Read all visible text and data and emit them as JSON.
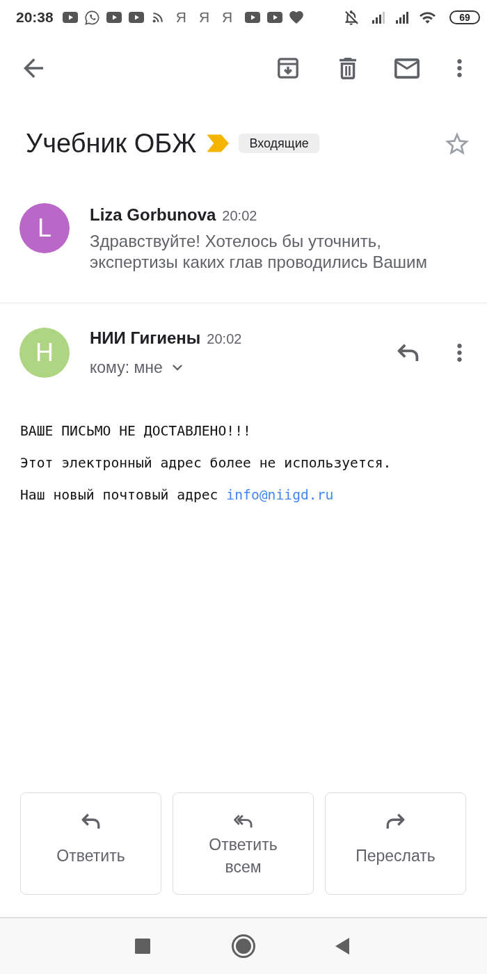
{
  "status_bar": {
    "time": "20:38",
    "notifications": [
      {
        "kind": "video"
      },
      {
        "kind": "chat"
      },
      {
        "kind": "video"
      },
      {
        "kind": "video"
      },
      {
        "kind": "feed"
      },
      {
        "kind": "glyph",
        "glyph": "Я"
      },
      {
        "kind": "glyph",
        "glyph": "Я"
      },
      {
        "kind": "glyph",
        "glyph": "Я"
      },
      {
        "kind": "video"
      },
      {
        "kind": "video"
      },
      {
        "kind": "heart"
      }
    ],
    "battery": "69"
  },
  "thread": {
    "subject": "Учебник ОБЖ",
    "important": true,
    "label": "Входящие",
    "starred": false
  },
  "messages": [
    {
      "expanded": false,
      "avatar_letter": "L",
      "color": "#ba68c8",
      "sender": "Liza Gorbunova",
      "time": "20:02",
      "snippet": "Здравствуйте! Хотелось бы уточнить, экспертизы каких глав проводились Вашим"
    },
    {
      "expanded": true,
      "avatar_letter": "Н",
      "color": "#aed581",
      "sender": "НИИ Гигиены",
      "time": "20:02",
      "recipient": "кому: мне",
      "body": [
        {
          "text": "ВАШЕ ПИСЬМО НЕ ДОСТАВЛЕНО!!!"
        },
        {
          "text": "Этот электронный адрес более не используется."
        },
        {
          "text": "Наш новый почтовый адрес",
          "link": "info@niigd.ru"
        }
      ]
    }
  ],
  "actions": [
    {
      "kind": "reply",
      "label": "Ответить"
    },
    {
      "kind": "reply_all",
      "label": "Ответить всем"
    },
    {
      "kind": "forward",
      "label": "Переслать"
    }
  ]
}
